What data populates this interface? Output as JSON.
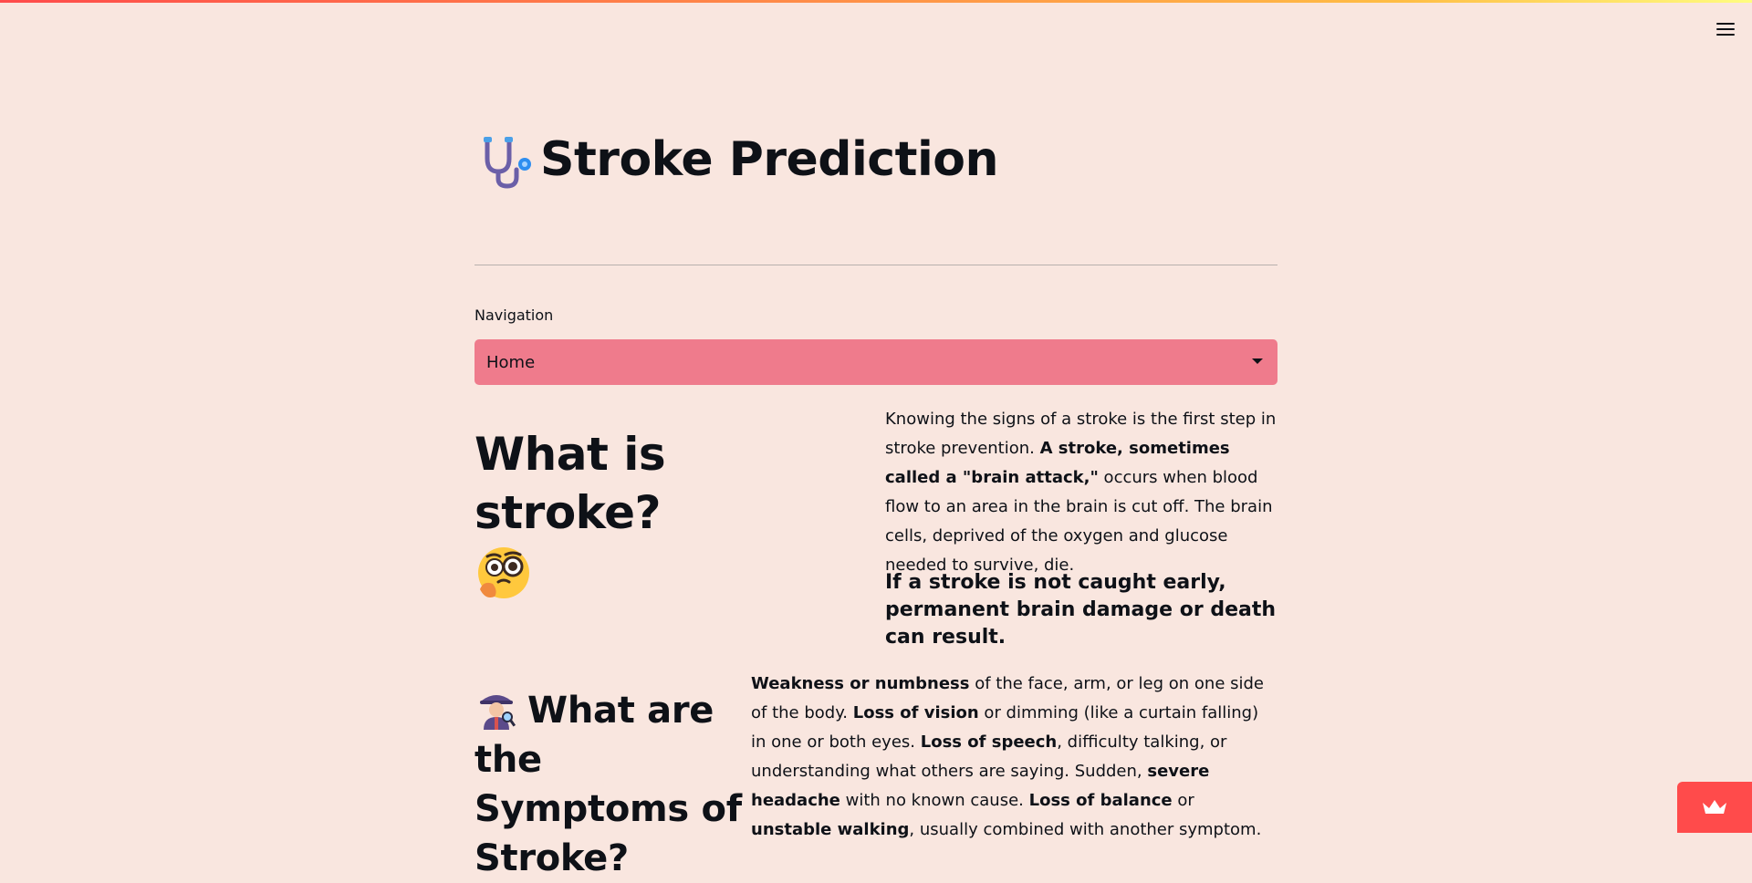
{
  "header": {
    "title": "Stroke Prediction",
    "title_icon": "stethoscope-icon",
    "menu_icon": "hamburger-menu-icon"
  },
  "navigation": {
    "label": "Navigation",
    "selected": "Home"
  },
  "section_stroke": {
    "heading": "What is stroke?",
    "heading_emoji": "face-with-monocle-icon",
    "para_part1": "Knowing the signs of a stroke is the first step in stroke prevention. ",
    "para_bold": "A stroke, sometimes called a \"brain attack,\"",
    "para_part2": " occurs when blood flow to an area in the brain is cut off. The brain cells, deprived of the oxygen and glucose needed to survive, die.",
    "warning": "If a stroke is not caught early, permanent brain damage or death can result."
  },
  "section_symptoms": {
    "heading": "What are the Symptoms of Stroke?",
    "heading_icon": "detective-icon",
    "b1": "Weakness or numbness",
    "t1": " of the face, arm, or leg on one side of the body. ",
    "b2": "Loss of vision",
    "t2": " or dimming (like a curtain falling) in one or both eyes. ",
    "b3": "Loss of speech",
    "t3": ", difficulty talking, or understanding what others are saying. Sudden, ",
    "b4": "severe headache",
    "t4": " with no known cause. ",
    "b5": "Loss of balance",
    "t5": " or ",
    "b6": "unstable walking",
    "t6": ", usually combined with another symptom."
  },
  "colors": {
    "background": "#f9e6df",
    "select_bg": "#ef7b8c",
    "accent": "#ff4b4b"
  },
  "badge_icon": "crown-icon"
}
